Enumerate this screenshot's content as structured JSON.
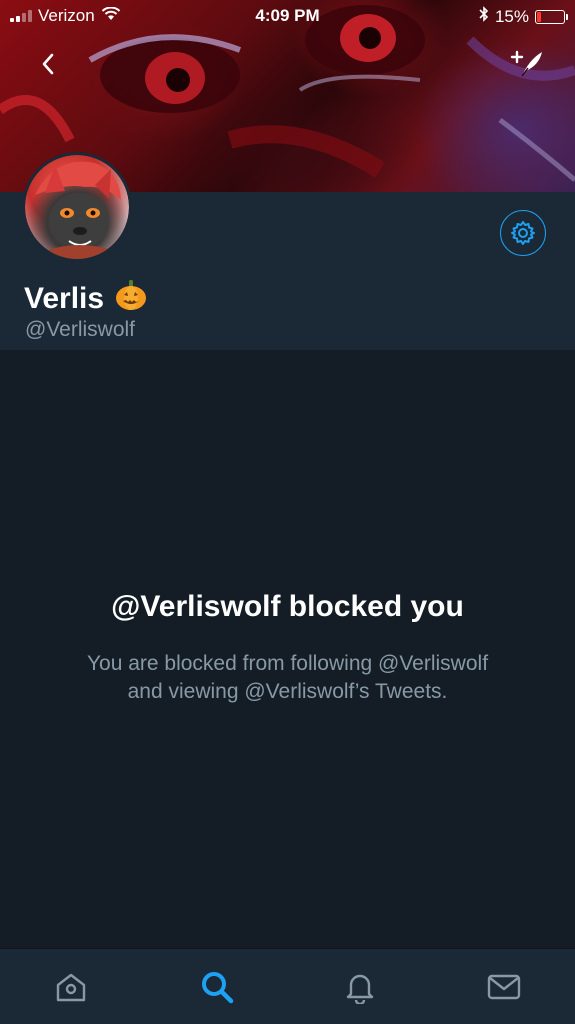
{
  "status_bar": {
    "carrier": "Verizon",
    "time": "4:09 PM",
    "battery_percent": "15%",
    "battery_level": 0.15,
    "icons": [
      "signal-icon",
      "wifi-icon",
      "bluetooth-icon",
      "battery-icon"
    ]
  },
  "nav": {
    "back_icon": "chevron-left-icon",
    "compose_icon": "compose-tweet-icon"
  },
  "profile": {
    "display_name": "Verlis",
    "name_emoji": "🎃",
    "username": "@Verliswolf",
    "settings_icon": "gear-icon"
  },
  "blocked": {
    "title": "@Verliswolf blocked you",
    "line1": "You are blocked from following @Verliswolf",
    "line2": "and viewing @Verliswolf’s Tweets."
  },
  "tab_bar": {
    "tabs": [
      {
        "icon": "home-icon",
        "active": false
      },
      {
        "icon": "search-icon",
        "active": true
      },
      {
        "icon": "notifications-icon",
        "active": false
      },
      {
        "icon": "messages-icon",
        "active": false
      }
    ]
  },
  "colors": {
    "background": "#141d26",
    "surface": "#1b2836",
    "accent": "#1da1f2",
    "secondary_text": "#8899a6",
    "inactive_icon": "#8899a6"
  }
}
